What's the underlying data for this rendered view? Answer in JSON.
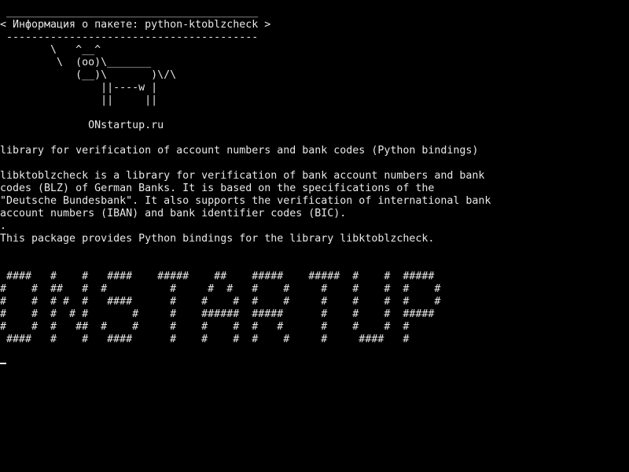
{
  "banner": {
    "border_top": " ________________________________________",
    "title": "< Информация о пакете: python-ktoblzcheck >",
    "border_bottom": " ----------------------------------------"
  },
  "cow": [
    "        \\   ^__^",
    "         \\  (oo)\\_______",
    "            (__)\\       )\\/\\",
    "                ||----w |",
    "                ||     ||"
  ],
  "site": "              ONstartup.ru",
  "summary": "library for verification of account numbers and bank codes (Python bindings)",
  "description": [
    "libktoblzcheck is a library for verification of bank account numbers and bank",
    "codes (BLZ) of German Banks. It is based on the specifications of the",
    "\"Deutsche Bundesbank\". It also supports the verification of international bank",
    "account numbers (IBAN) and bank identifier codes (BIC).",
    ".",
    "This package provides Python bindings for the library libktoblzcheck."
  ],
  "ascii_art": [
    " ####   #    #   ####    #####    ##    #####    #####  #    #  #####",
    "#    #  ##   #  #          #     #  #   #    #     #    #    #  #    #",
    "#    #  # #  #   ####      #    #    #  #    #     #    #    #  #    #",
    "#    #  #  # #       #     #    ######  #####      #    #    #  #####",
    "#    #  #   ##  #    #     #    #    #  #   #      #    #    #  #",
    " ####   #    #   ####      #    #    #  #    #     #     ####   #"
  ]
}
